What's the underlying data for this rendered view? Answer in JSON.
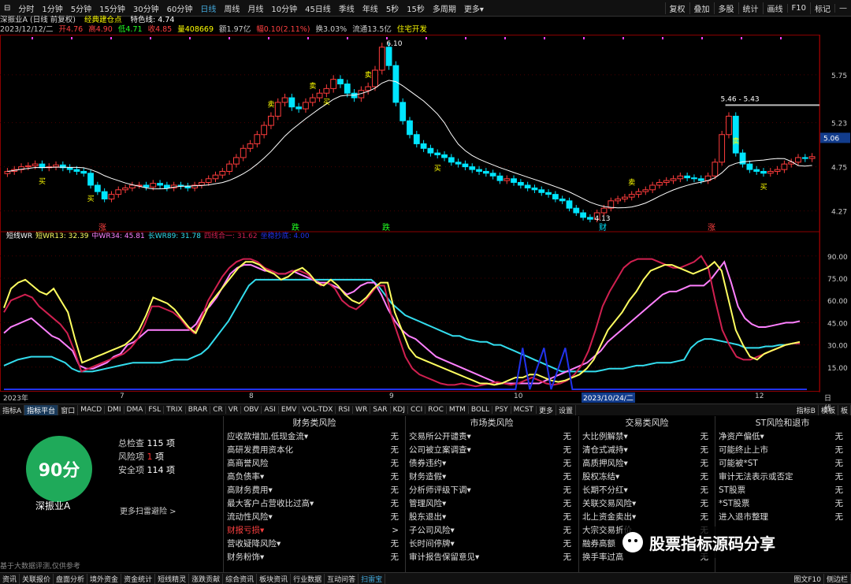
{
  "top_tabs": [
    "分时",
    "1分钟",
    "5分钟",
    "15分钟",
    "30分钟",
    "60分钟",
    "日线",
    "周线",
    "月线",
    "10分钟",
    "45日线",
    "季线",
    "年线",
    "5秒",
    "15秒",
    "多周期",
    "更多▾"
  ],
  "active_top_tab": "日线",
  "right_tabs": [
    "复权",
    "叠加",
    "多股",
    "统计",
    "画线",
    "F10",
    "标记",
    "—"
  ],
  "info": {
    "title": "深振业A (日线 前复权)",
    "indicator": "经典建仓点",
    "feature": "特色线: 4.74",
    "date": "2023/12/12/二",
    "open": "开4.76",
    "high": "高4.90",
    "low": "低4.71",
    "close": "收4.85",
    "volume": "量408669",
    "amount": "额1.97亿",
    "change": "幅0.10(2.11%)",
    "turnover": "换3.03%",
    "float_shares": "流通13.5亿",
    "sector": "住宅开发"
  },
  "price_axis": [
    "5.75",
    "5.23",
    "4.75",
    "4.27"
  ],
  "price_marker": "5.06",
  "high_label": "6.10",
  "low_label": "4.13",
  "peak_range_label": "5.46 - 5.43",
  "candle_marks": [
    {
      "text": "买",
      "color": "#ff0"
    },
    {
      "text": "卖",
      "color": "#ff0"
    }
  ],
  "event_labels": [
    "涨",
    "跌",
    "财",
    "涨"
  ],
  "wr_legend": {
    "name": "短线WR",
    "wr13": "短WR13: 32.39",
    "wr34": "中WR34: 45.81",
    "wr89": "长WR89: 31.78",
    "l4": "四线合一: 31.62",
    "l5": "坐稳抄底: 4.00"
  },
  "wr_axis": [
    "90.00",
    "75.00",
    "60.00",
    "45.00",
    "30.00",
    "15.00"
  ],
  "x_axis": [
    "2023年",
    "7",
    "8",
    "9",
    "10",
    "2023/10/24/二",
    "12",
    "日线"
  ],
  "ind_tabs": [
    "指标A",
    "指标平台",
    "窗口",
    "MACD",
    "DMI",
    "DMA",
    "FSL",
    "TRIX",
    "BRAR",
    "CR",
    "VR",
    "OBV",
    "ASI",
    "EMV",
    "VOL-TDX",
    "RSI",
    "WR",
    "SAR",
    "KDJ",
    "CCI",
    "ROC",
    "MTM",
    "BOLL",
    "PSY",
    "MCST",
    "更多",
    "设置"
  ],
  "ind_tabs_right": [
    "指标B",
    "模板",
    "板"
  ],
  "score": {
    "value": "90分",
    "stock": "深振业A",
    "total_label": "总检查",
    "total_value": "115 项",
    "risk_label": "风险项",
    "risk_value": "1",
    "risk_unit": "项",
    "safe_label": "安全项",
    "safe_value": "114 项",
    "more": "更多扫雷避险 >",
    "note": "基于大数据评测,仅供参考"
  },
  "risk_columns": [
    {
      "title": "财务类风险",
      "items": [
        {
          "label": "应收款增加,低现金流▾",
          "value": "无"
        },
        {
          "label": "高研发费用资本化",
          "value": "无"
        },
        {
          "label": "高商誉风险",
          "value": "无"
        },
        {
          "label": "高负债率▾",
          "value": "无"
        },
        {
          "label": "高财务费用▾",
          "value": "无"
        },
        {
          "label": "最大客户占营收比过高▾",
          "value": "无"
        },
        {
          "label": "流动性风险▾",
          "value": "无"
        },
        {
          "label": "财报亏损▾",
          "value": ">",
          "red": true
        },
        {
          "label": "营收疑降风险▾",
          "value": "无"
        },
        {
          "label": "财务粉饰▾",
          "value": "无"
        }
      ]
    },
    {
      "title": "市场类风险",
      "items": [
        {
          "label": "交易所公开谴责▾",
          "value": "无"
        },
        {
          "label": "公司被立案调查▾",
          "value": "无"
        },
        {
          "label": "债券违约▾",
          "value": "无"
        },
        {
          "label": "财务造假▾",
          "value": "无"
        },
        {
          "label": "分析师评级下调▾",
          "value": "无"
        },
        {
          "label": "管理风险▾",
          "value": "无"
        },
        {
          "label": "股东退出▾",
          "value": "无"
        },
        {
          "label": "子公司风险▾",
          "value": "无"
        },
        {
          "label": "长时间停牌▾",
          "value": "无"
        },
        {
          "label": "审计报告保留意见▾",
          "value": "无"
        }
      ]
    },
    {
      "title": "交易类风险",
      "items": [
        {
          "label": "大比例解禁▾",
          "value": "无"
        },
        {
          "label": "清仓式减持▾",
          "value": "无"
        },
        {
          "label": "高质押风险▾",
          "value": "无"
        },
        {
          "label": "股权冻结▾",
          "value": "无"
        },
        {
          "label": "长期不分红▾",
          "value": "无"
        },
        {
          "label": "关联交易风险▾",
          "value": "无"
        },
        {
          "label": "北上资金卖出▾",
          "value": "无"
        },
        {
          "label": "大宗交易折价",
          "value": "无"
        },
        {
          "label": "融券高额",
          "value": "无"
        },
        {
          "label": "换手率过高",
          "value": "无"
        }
      ]
    },
    {
      "title": "ST风险和退市",
      "items": [
        {
          "label": "净资产偏低▾",
          "value": "无"
        },
        {
          "label": "可能终止上市",
          "value": "无"
        },
        {
          "label": "可能被*ST",
          "value": "无"
        },
        {
          "label": "审计无法表示或否定",
          "value": "无"
        },
        {
          "label": "ST股票",
          "value": "无"
        },
        {
          "label": "*ST股票",
          "value": "无"
        },
        {
          "label": "进入退市整理",
          "value": "无"
        }
      ]
    }
  ],
  "watermark": "股票指标源码分享",
  "bottom_tabs": [
    "资讯",
    "关联报价",
    "盘面分析",
    "境外资金",
    "资金统计",
    "短线精灵",
    "涨跌贡献",
    "综合资讯",
    "板块资讯",
    "行业数据",
    "互动问答",
    "扫雷宝"
  ],
  "bottom_right": [
    "图文F10",
    "侧边栏"
  ],
  "colors": {
    "up": "#ff3c3c",
    "down": "#00e5ff",
    "ma": "#ffffff",
    "wr13": "#ffff60",
    "wr34": "#ff80ff",
    "wr89": "#33ddee",
    "l4": "#d02050",
    "l5": "#2233ee",
    "score_green": "#1faa5a"
  },
  "chart_data": {
    "type": "candlestick",
    "price_ylim": [
      4.13,
      6.1
    ],
    "price_series_close": [
      4.7,
      4.72,
      4.75,
      4.76,
      4.78,
      4.74,
      4.75,
      4.77,
      4.74,
      4.72,
      4.7,
      4.68,
      4.55,
      4.48,
      4.4,
      4.45,
      4.5,
      4.52,
      4.55,
      4.55,
      4.53,
      4.57,
      4.55,
      4.52,
      4.55,
      4.54,
      4.52,
      4.55,
      4.58,
      4.62,
      4.66,
      4.7,
      4.78,
      4.85,
      4.95,
      5.0,
      5.1,
      5.2,
      5.3,
      5.45,
      5.5,
      5.4,
      5.38,
      5.45,
      5.5,
      5.55,
      5.6,
      5.7,
      5.65,
      5.55,
      5.5,
      5.58,
      5.62,
      5.8,
      6.05,
      5.85,
      5.45,
      5.25,
      5.1,
      5.0,
      4.95,
      4.9,
      4.88,
      4.85,
      4.8,
      4.78,
      4.75,
      4.72,
      4.7,
      4.68,
      4.65,
      4.6,
      4.62,
      4.58,
      4.55,
      4.52,
      4.5,
      4.47,
      4.45,
      4.4,
      4.38,
      4.3,
      4.25,
      4.2,
      4.18,
      4.25,
      4.3,
      4.38,
      4.4,
      4.42,
      4.45,
      4.48,
      4.5,
      4.55,
      4.58,
      4.6,
      4.62,
      4.65,
      4.63,
      4.62,
      4.6,
      4.65,
      4.8,
      5.1,
      5.3,
      4.9,
      4.78,
      4.72,
      4.7,
      4.68,
      4.7,
      4.72,
      4.78,
      4.8,
      4.85,
      4.84,
      4.86
    ],
    "wr13": [
      55,
      68,
      72,
      74,
      70,
      66,
      64,
      68,
      60,
      52,
      34,
      18,
      20,
      22,
      24,
      26,
      28,
      30,
      34,
      40,
      50,
      62,
      60,
      58,
      54,
      48,
      42,
      38,
      48,
      58,
      64,
      70,
      76,
      82,
      86,
      86,
      84,
      80,
      78,
      74,
      76,
      80,
      82,
      78,
      72,
      70,
      74,
      70,
      64,
      60,
      58,
      62,
      68,
      72,
      72,
      52,
      40,
      28,
      22,
      20,
      18,
      16,
      14,
      12,
      10,
      8,
      6,
      4,
      4,
      3,
      4,
      6,
      8,
      8,
      10,
      10,
      8,
      6,
      5,
      6,
      8,
      10,
      14,
      20,
      30,
      40,
      46,
      52,
      60,
      66,
      74,
      80,
      82,
      84,
      84,
      82,
      80,
      78,
      80,
      82,
      86,
      80,
      60,
      40,
      30,
      22,
      20,
      24,
      26,
      28,
      30,
      31,
      32
    ],
    "wr34": [
      38,
      42,
      44,
      46,
      48,
      44,
      40,
      36,
      34,
      30,
      26,
      16,
      14,
      14,
      16,
      18,
      22,
      24,
      30,
      32,
      36,
      40,
      40,
      40,
      40,
      40,
      40,
      40,
      44,
      52,
      56,
      62,
      70,
      78,
      82,
      84,
      84,
      82,
      80,
      80,
      78,
      78,
      80,
      78,
      76,
      74,
      72,
      72,
      70,
      68,
      64,
      66,
      70,
      72,
      72,
      64,
      54,
      46,
      40,
      36,
      34,
      30,
      26,
      22,
      20,
      18,
      16,
      14,
      12,
      10,
      8,
      6,
      4,
      4,
      4,
      4,
      4,
      4,
      4,
      6,
      8,
      10,
      12,
      14,
      16,
      18,
      22,
      26,
      32,
      36,
      40,
      44,
      48,
      52,
      56,
      60,
      64,
      66,
      66,
      68,
      70,
      70,
      70,
      74,
      80,
      86,
      72,
      56,
      48,
      44,
      42,
      42,
      43,
      44,
      45,
      45,
      46
    ],
    "wr89": [
      16,
      18,
      20,
      21,
      22,
      22,
      22,
      22,
      20,
      18,
      14,
      12,
      12,
      12,
      13,
      14,
      15,
      16,
      17,
      18,
      18,
      18,
      18,
      18,
      19,
      20,
      20,
      20,
      22,
      24,
      28,
      34,
      40,
      46,
      54,
      62,
      70,
      74,
      74,
      74,
      74,
      74,
      74,
      74,
      74,
      74,
      74,
      74,
      74,
      74,
      74,
      74,
      74,
      74,
      74,
      70,
      64,
      58,
      54,
      50,
      48,
      46,
      44,
      42,
      40,
      38,
      36,
      36,
      34,
      33,
      32,
      32,
      30,
      30,
      28,
      26,
      24,
      22,
      20,
      18,
      16,
      14,
      12,
      12,
      12,
      12,
      12,
      12,
      13,
      14,
      14,
      14,
      15,
      16,
      16,
      17,
      18,
      18,
      18,
      19,
      20,
      28,
      32,
      34,
      34,
      33,
      32,
      31,
      30,
      28,
      28,
      28,
      29,
      29,
      30,
      30,
      31,
      31
    ],
    "l4": [
      52,
      60,
      62,
      64,
      62,
      56,
      52,
      48,
      44,
      38,
      26,
      12,
      14,
      16,
      18,
      20,
      22,
      24,
      28,
      34,
      44,
      56,
      56,
      54,
      52,
      48,
      42,
      38,
      48,
      60,
      68,
      76,
      82,
      86,
      88,
      88,
      86,
      82,
      80,
      78,
      78,
      80,
      80,
      78,
      74,
      70,
      72,
      68,
      60,
      56,
      54,
      58,
      64,
      70,
      70,
      50,
      36,
      22,
      14,
      10,
      8,
      6,
      4,
      3,
      3,
      4,
      3,
      2,
      3,
      4,
      5,
      4,
      3,
      4,
      6,
      8,
      6,
      4,
      3,
      4,
      6,
      10,
      16,
      26,
      40,
      56,
      66,
      74,
      82,
      86,
      88,
      88,
      88,
      86,
      84,
      82,
      82,
      84,
      86,
      90,
      82,
      60,
      40,
      30,
      22,
      20,
      20,
      22,
      24,
      26,
      28,
      30,
      31,
      31
    ],
    "l5_spikes": [
      [
        0,
        0
      ],
      [
        72,
        0
      ],
      [
        73,
        28
      ],
      [
        74,
        0
      ],
      [
        76,
        28
      ],
      [
        77,
        0
      ],
      [
        79,
        28
      ],
      [
        80,
        0
      ],
      [
        113,
        0
      ]
    ]
  }
}
